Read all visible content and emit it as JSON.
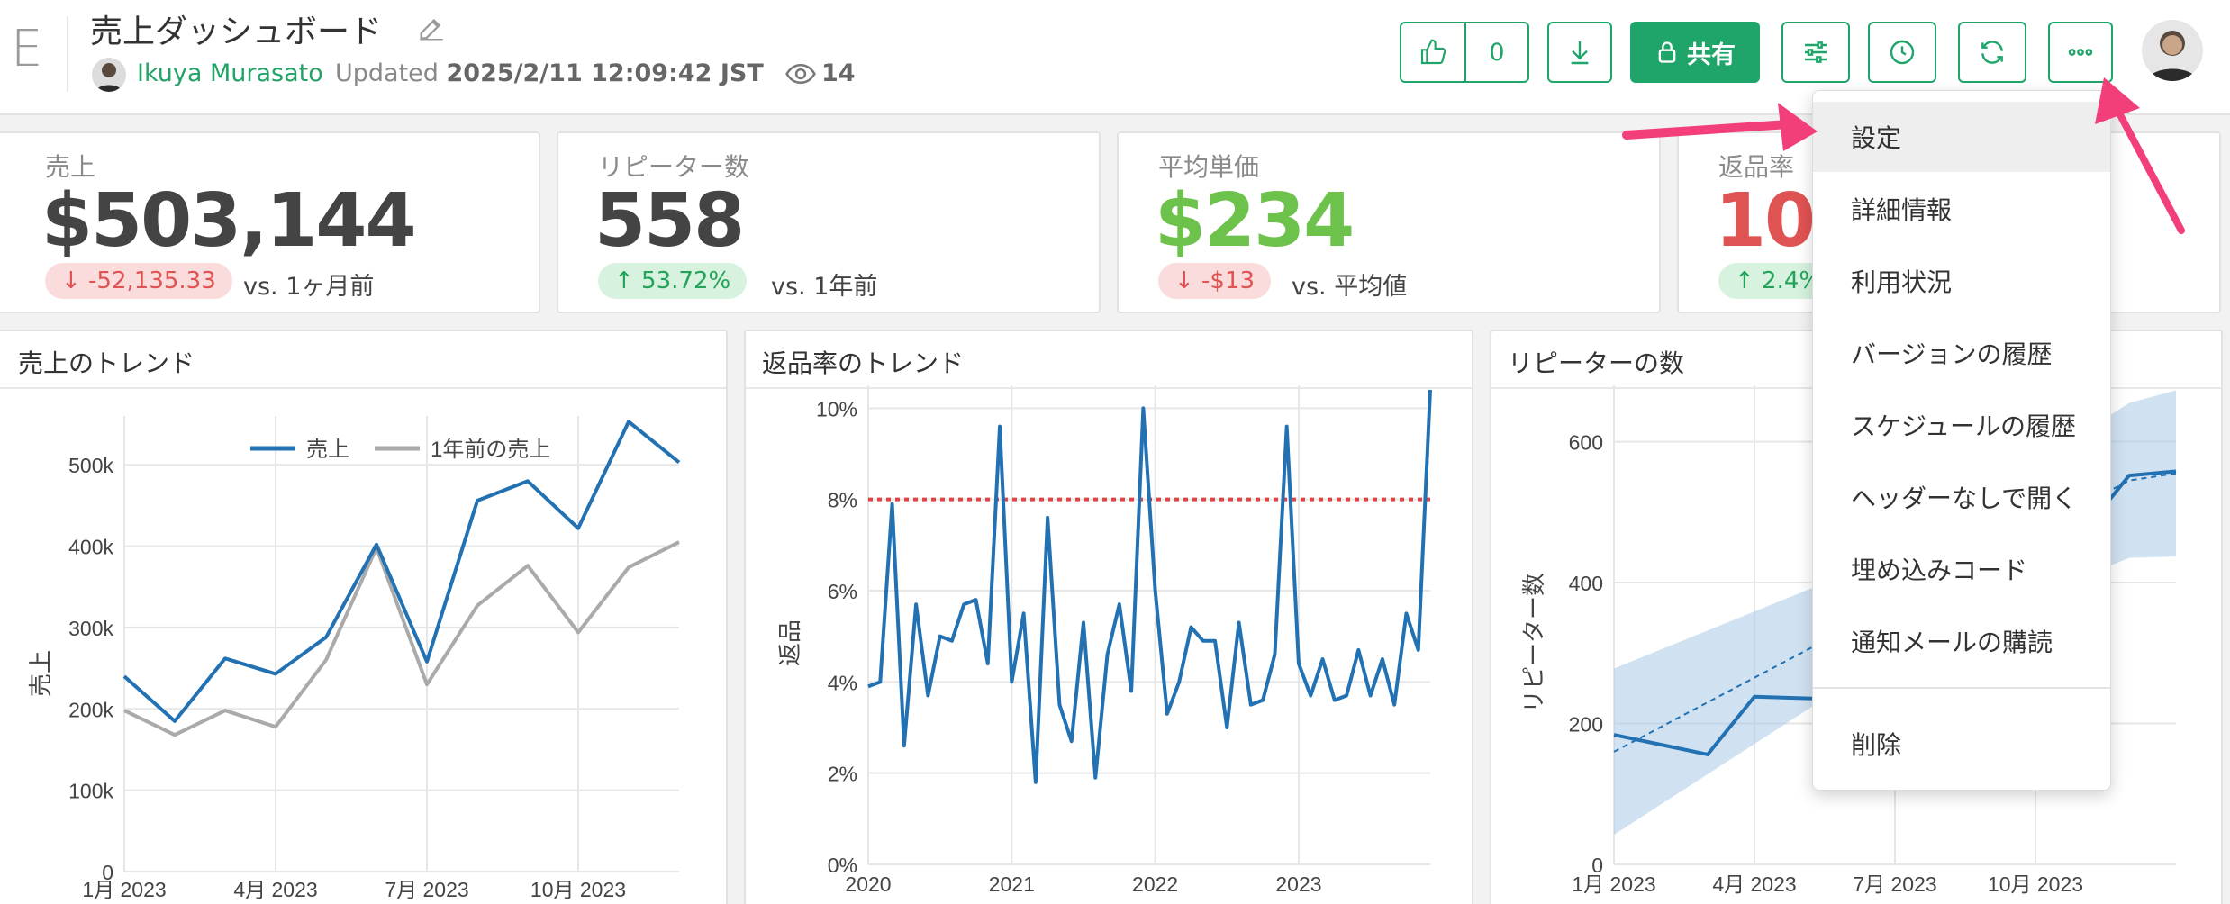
{
  "header": {
    "app_letter": "E",
    "title": "売上ダッシュボード",
    "author": "Ikuya Murasato",
    "updated_label": "Updated",
    "updated_time": "2025/2/11 12:09:42 JST",
    "views": "14",
    "like_count": "0",
    "share_label": "共有",
    "icons": [
      "edit-icon",
      "eye-icon",
      "thumbs-up-icon",
      "download-icon",
      "lock-icon",
      "sliders-icon",
      "clock-icon",
      "refresh-icon",
      "more-icon"
    ]
  },
  "kpis": [
    {
      "label": "売上",
      "value": "$503,144",
      "badge": "↓  -52,135.33",
      "badge_type": "down",
      "compare": "vs. 1ヶ月前",
      "value_color": "#444444"
    },
    {
      "label": "リピーター数",
      "value": "558",
      "badge": "↑  53.72%",
      "badge_type": "up",
      "compare": "vs. 1年前",
      "value_color": "#444444"
    },
    {
      "label": "平均単価",
      "value": "$234",
      "badge": "↓  -$13",
      "badge_type": "down",
      "compare": "vs. 平均値",
      "value_color": "#6cc24a"
    },
    {
      "label": "返品率",
      "value": "10.",
      "badge": "↑  2.4%",
      "badge_type": "up",
      "compare": "",
      "value_color": "#e05353"
    }
  ],
  "panels": {
    "sales_title": "売上のトレンド",
    "returns_title": "返品率のトレンド",
    "repeaters_title": "リピーターの数"
  },
  "menu": {
    "items": [
      "設定",
      "詳細情報",
      "利用状況",
      "バージョンの履歴",
      "スケジュールの履歴",
      "ヘッダーなしで開く",
      "埋め込みコード",
      "通知メールの購読"
    ],
    "delete": "削除"
  },
  "colors": {
    "accent": "#1fa56a",
    "blue": "#2271b3",
    "gray": "#aaaaaa",
    "red": "#e05353",
    "pink_arrow": "#f23f7a"
  },
  "chart_data": [
    {
      "type": "line",
      "title": "売上のトレンド",
      "ylabel": "売上",
      "x": [
        "2023-01",
        "2023-02",
        "2023-03",
        "2023-04",
        "2023-05",
        "2023-06",
        "2023-07",
        "2023-08",
        "2023-09",
        "2023-10",
        "2023-11",
        "2023-12"
      ],
      "x_ticks": [
        "1月 2023",
        "4月 2023",
        "7月 2023",
        "10月 2023"
      ],
      "y_ticks": [
        "0",
        "100k",
        "200k",
        "300k",
        "400k",
        "500k"
      ],
      "ylim": [
        0,
        560000
      ],
      "series": [
        {
          "name": "売上",
          "values": [
            240000,
            185000,
            262000,
            243000,
            288000,
            402000,
            258000,
            456000,
            480000,
            422000,
            553000,
            503000
          ]
        },
        {
          "name": "1年前の売上",
          "values": [
            198000,
            168000,
            198000,
            178000,
            260000,
            398000,
            230000,
            327000,
            376000,
            294000,
            374000,
            405000
          ]
        }
      ],
      "legend": "top"
    },
    {
      "type": "line",
      "title": "返品率のトレンド",
      "ylabel": "返品",
      "x_ticks": [
        "2020",
        "2021",
        "2022",
        "2023"
      ],
      "y_ticks": [
        "0%",
        "2%",
        "4%",
        "6%",
        "8%",
        "10%"
      ],
      "xlim": [
        "2020-01",
        "2023-12"
      ],
      "ylim": [
        0,
        10.5
      ],
      "threshold": 8,
      "series": [
        {
          "name": "返品率",
          "values": [
            3.9,
            4.0,
            7.9,
            2.6,
            5.7,
            3.7,
            5.0,
            4.9,
            5.7,
            5.8,
            4.4,
            9.6,
            4.0,
            5.5,
            1.8,
            7.6,
            3.5,
            2.7,
            5.3,
            1.9,
            4.6,
            5.7,
            3.8,
            10.0,
            6.0,
            3.3,
            4.0,
            5.2,
            4.9,
            4.9,
            3.0,
            5.3,
            3.5,
            3.6,
            4.6,
            9.6,
            4.4,
            3.7,
            4.5,
            3.6,
            3.7,
            4.7,
            3.7,
            4.5,
            3.5,
            5.5,
            4.7,
            10.4
          ]
        }
      ]
    },
    {
      "type": "line",
      "title": "リピーターの数",
      "ylabel": "リピーター数",
      "x_ticks": [
        "1月 2023",
        "4月 2023",
        "7月 2023",
        "10月 2023"
      ],
      "y_ticks": [
        "0",
        "200",
        "400",
        "600"
      ],
      "ylim": [
        0,
        680
      ],
      "series": [
        {
          "name": "リピーター数",
          "values": [
            184,
            170,
            156,
            238,
            236,
            234,
            300,
            340,
            380,
            420,
            470,
            552,
            558
          ]
        },
        {
          "name": "トレンド",
          "values": [
            160,
            195,
            230,
            265,
            300,
            335,
            370,
            405,
            440,
            475,
            510,
            545,
            555
          ]
        }
      ]
    }
  ]
}
